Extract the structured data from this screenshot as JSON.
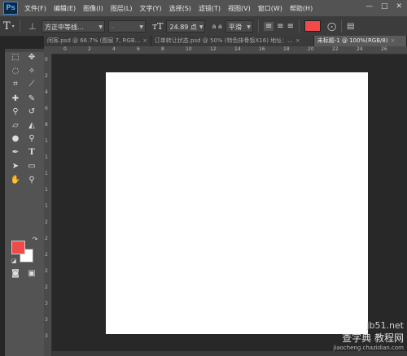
{
  "app": {
    "logo": "Ps"
  },
  "menu": [
    "文件(F)",
    "编辑(E)",
    "图像(I)",
    "图层(L)",
    "文字(Y)",
    "选择(S)",
    "滤镜(T)",
    "视图(V)",
    "窗口(W)",
    "帮助(H)"
  ],
  "window_controls": {
    "minimize": "—",
    "restore": "□",
    "close": "✕"
  },
  "options": {
    "font_family": "方正中等线...",
    "font_style": "-",
    "font_size": "24.89 点",
    "antialias_label": "a a",
    "antialias": "平滑",
    "text_color": "#f04a4a"
  },
  "tabs": [
    {
      "label": "闲客.psd @ 66.7% (图层 7, RGB...",
      "close": "×",
      "active": false
    },
    {
      "label": "订单转让状态.psd @ 50% (特色排骨饭X16) 地址：...",
      "close": "×",
      "active": false
    },
    {
      "label": "未标题-1 @ 100%(RGB/8)",
      "close": "×",
      "active": true
    }
  ],
  "ruler_ticks": [
    "0",
    "2",
    "4",
    "6",
    "8",
    "10",
    "12",
    "14",
    "16",
    "18",
    "20",
    "22",
    "24",
    "26"
  ],
  "ruler_left_ticks": [
    "0",
    "2",
    "4",
    "6",
    "8",
    "1",
    "1",
    "1",
    "1",
    "1",
    "2",
    "2",
    "2",
    "2",
    "2",
    "3",
    "3",
    "3"
  ],
  "colors": {
    "foreground": "#f04a4a",
    "background": "#ffffff"
  },
  "watermark": {
    "site": "jb51.net",
    "main": "查字典 教程网",
    "url": "jiaocheng.chazidian.com"
  }
}
